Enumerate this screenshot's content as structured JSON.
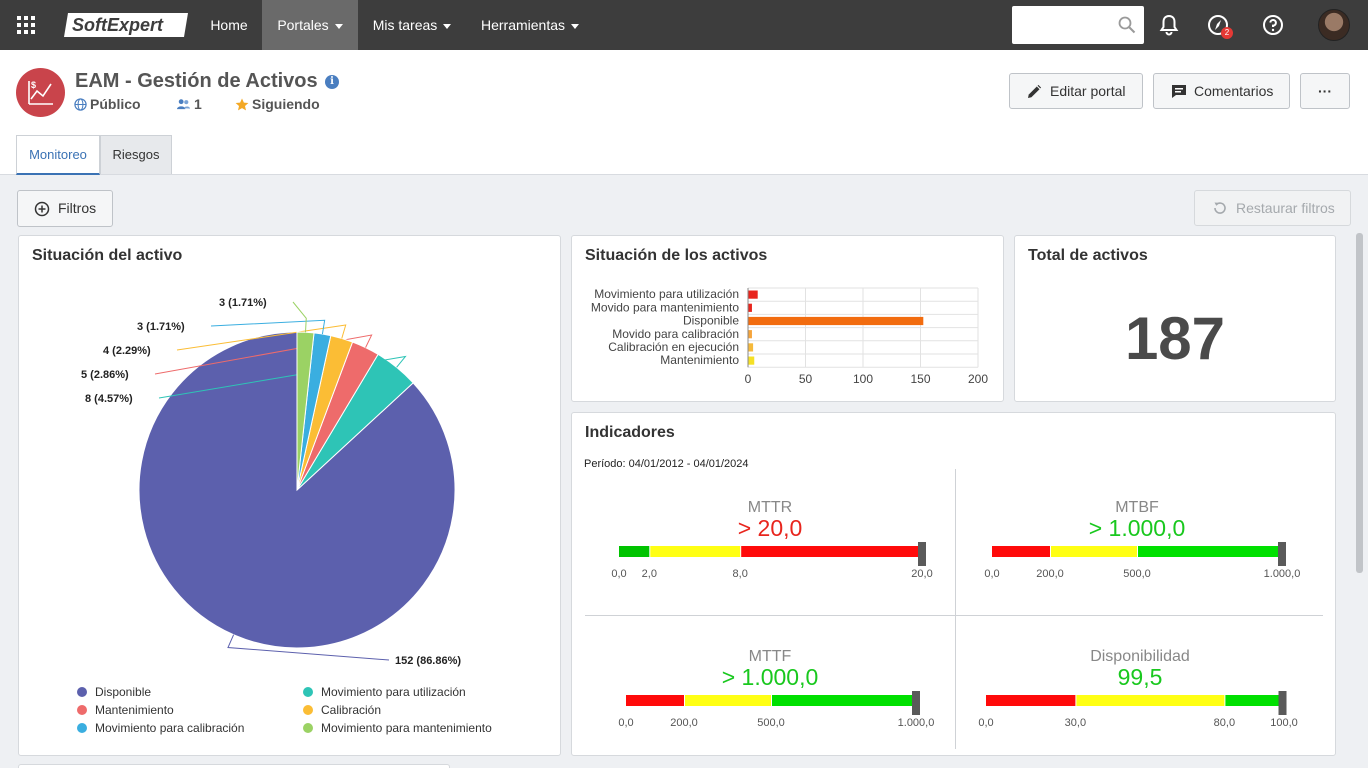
{
  "nav": {
    "logo": "SoftExpert",
    "items": [
      {
        "label": "Home"
      },
      {
        "label": "Portales"
      },
      {
        "label": "Mis tareas"
      },
      {
        "label": "Herramientas"
      }
    ],
    "notification_count": "2"
  },
  "portal": {
    "title": "EAM - Gestión de Activos",
    "visibility": "Público",
    "members": "1",
    "following": "Siguiendo",
    "brand_color": "#c9444b"
  },
  "actions": {
    "edit": "Editar portal",
    "comments": "Comentarios",
    "more": "···"
  },
  "tabs": [
    {
      "label": "Monitoreo",
      "active": true
    },
    {
      "label": "Riesgos",
      "active": false
    }
  ],
  "filters": {
    "filter_label": "Filtros",
    "restore_label": "Restaurar filtros"
  },
  "pie_panel": {
    "title": "Situación del activo",
    "chart_data": {
      "type": "pie",
      "slices": [
        {
          "name": "Disponible",
          "value": 152,
          "label": "152 (86.86%)",
          "color": "#5c60ad"
        },
        {
          "name": "Movimiento para utilización",
          "value": 8,
          "label": "8 (4.57%)",
          "color": "#2ec4b6"
        },
        {
          "name": "Mantenimiento",
          "value": 5,
          "label": "5 (2.86%)",
          "color": "#ee6b6b"
        },
        {
          "name": "Calibración",
          "value": 4,
          "label": "4 (2.29%)",
          "color": "#fbbd35"
        },
        {
          "name": "Movimiento para calibración",
          "value": 3,
          "label": "3 (1.71%)",
          "color": "#3aaee0"
        },
        {
          "name": "Movimiento para mantenimiento",
          "value": 3,
          "label": "3 (1.71%)",
          "color": "#9bd264"
        }
      ]
    }
  },
  "bar_panel": {
    "title": "Situación de los activos",
    "chart_data": {
      "type": "bar",
      "orientation": "horizontal",
      "categories": [
        "Movimiento para utilización",
        "Movido para mantenimiento",
        "Disponible",
        "Movido para calibración",
        "Calibración en ejecución",
        "Mantenimiento"
      ],
      "values": [
        8,
        3,
        152,
        3,
        4,
        5
      ],
      "colors": [
        "#e8251d",
        "#e8251d",
        "#f26c0f",
        "#f5a43b",
        "#f5b93b",
        "#f5e025"
      ],
      "xlim": [
        0,
        200
      ],
      "xticks": [
        "0",
        "50",
        "100",
        "150",
        "200"
      ],
      "grid": true
    }
  },
  "total_panel": {
    "title": "Total de activos",
    "value": "187"
  },
  "indicators": {
    "title": "Indicadores",
    "period": "Período: 04/01/2012 - 04/01/2024",
    "gauges": [
      {
        "name": "MTTR",
        "value": "> 20,0",
        "value_color": "#e8251d",
        "max": 20,
        "pointer": 20,
        "segments": [
          {
            "to": 2,
            "color": "#00c300"
          },
          {
            "to": 8,
            "color": "#ffff14"
          },
          {
            "to": 20,
            "color": "#ff0a0a"
          }
        ],
        "ticks": [
          {
            "v": 0,
            "label": "0,0"
          },
          {
            "v": 2,
            "label": "2,0"
          },
          {
            "v": 8,
            "label": "8,0"
          },
          {
            "v": 20,
            "label": "20,0"
          }
        ]
      },
      {
        "name": "MTBF",
        "value": "> 1.000,0",
        "value_color": "#19c81e",
        "max": 1000,
        "pointer": 1000,
        "segments": [
          {
            "to": 200,
            "color": "#ff0a0a"
          },
          {
            "to": 500,
            "color": "#ffff14"
          },
          {
            "to": 1000,
            "color": "#00e000"
          }
        ],
        "ticks": [
          {
            "v": 0,
            "label": "0,0"
          },
          {
            "v": 200,
            "label": "200,0"
          },
          {
            "v": 500,
            "label": "500,0"
          },
          {
            "v": 1000,
            "label": "1.000,0"
          }
        ]
      },
      {
        "name": "MTTF",
        "value": "> 1.000,0",
        "value_color": "#19c81e",
        "max": 1000,
        "pointer": 1000,
        "segments": [
          {
            "to": 200,
            "color": "#ff0a0a"
          },
          {
            "to": 500,
            "color": "#ffff14"
          },
          {
            "to": 1000,
            "color": "#00e000"
          }
        ],
        "ticks": [
          {
            "v": 0,
            "label": "0,0"
          },
          {
            "v": 200,
            "label": "200,0"
          },
          {
            "v": 500,
            "label": "500,0"
          },
          {
            "v": 1000,
            "label": "1.000,0"
          }
        ]
      },
      {
        "name": "Disponibilidad",
        "value": "99,5",
        "value_color": "#19c81e",
        "max": 100,
        "pointer": 99.5,
        "segments": [
          {
            "to": 30,
            "color": "#ff0a0a"
          },
          {
            "to": 80,
            "color": "#ffff14"
          },
          {
            "to": 100,
            "color": "#00e000"
          }
        ],
        "ticks": [
          {
            "v": 0,
            "label": "0,0"
          },
          {
            "v": 30,
            "label": "30,0"
          },
          {
            "v": 80,
            "label": "80,0"
          },
          {
            "v": 100,
            "label": "100,0"
          }
        ]
      }
    ]
  }
}
